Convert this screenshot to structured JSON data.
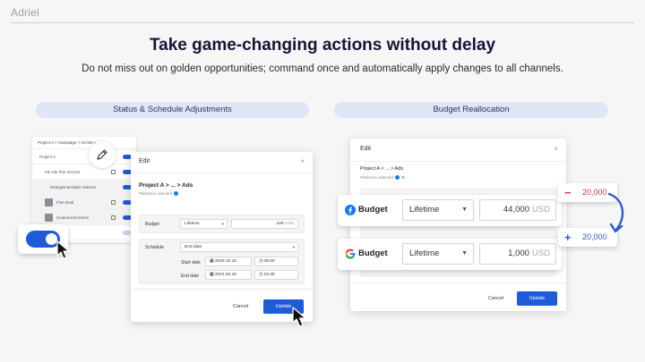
{
  "brand": "Adriel",
  "headline": "Take game-changing actions without delay",
  "subline": "Do not miss out on golden opportunities; command once and automatically apply changes to all channels.",
  "pills": {
    "left": "Status & Schedule Adjustments",
    "right": "Budget Reallocation"
  },
  "left_panel": {
    "table": {
      "breadcrumb": "Project A > Campaign > Ad Set > ...",
      "rows": [
        {
          "text": "Project A",
          "toggle": "on"
        },
        {
          "text": "FB A/B Test 201124",
          "toggle": "on"
        },
        {
          "text": "Retarget  Broader Interest",
          "toggle": "on"
        },
        {
          "text": "Fine Deal",
          "toggle": "on"
        },
        {
          "text": "Customized Items",
          "toggle": "on"
        },
        {
          "text": "",
          "toggle": "off"
        }
      ]
    },
    "edit_modal": {
      "title": "Edit",
      "close": "×",
      "breadcrumb": "Project A > ... > Ads",
      "platforms": "Platforms selected",
      "budget_label": "Budget",
      "budget_type": "Lifetime",
      "budget_amount": "100",
      "budget_unit": "USD",
      "schedule_label": "Schedule",
      "schedule_value": "End date",
      "start_label": "Start date",
      "start_date": "2020.12.15",
      "start_time": "08:30",
      "end_label": "End date",
      "end_date": "2021.02.15",
      "end_time": "22:30",
      "cancel": "Cancel",
      "update": "Update"
    }
  },
  "right_panel": {
    "modal": {
      "title": "Edit",
      "close": "×",
      "breadcrumb": "Project A > ... > Ads",
      "platforms": "Platforms selected",
      "cancel": "Cancel",
      "update": "Update"
    },
    "rows": [
      {
        "platform_icon": "facebook-icon",
        "label": "Budget",
        "type": "Lifetime",
        "amount": "44,000",
        "unit": "USD"
      },
      {
        "platform_icon": "google-icon",
        "label": "Budget",
        "type": "Lifetime",
        "amount": "1,000",
        "unit": "USD"
      }
    ],
    "chips": {
      "minus_symbol": "−",
      "minus_value": "20,000",
      "plus_symbol": "+",
      "plus_value": "20,000"
    }
  },
  "colors": {
    "accent": "#1f5bd6",
    "headline": "#15153a",
    "pill": "#dfe7f6",
    "negative": "#d23b3b",
    "facebook": "#1877f2"
  }
}
